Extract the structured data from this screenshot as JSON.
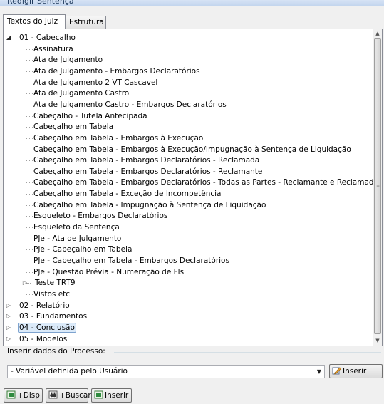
{
  "window": {
    "title": "Redigir Sentença"
  },
  "tabs": [
    {
      "label": "Textos do Juiz",
      "active": true
    },
    {
      "label": "Estrutura",
      "active": false
    }
  ],
  "tree": {
    "root": {
      "label": "01 - Cabeçalho",
      "expanded": true
    },
    "children": [
      "Assinatura",
      "Ata de Julgamento",
      "Ata de Julgamento - Embargos Declaratórios",
      "Ata de Julgamento 2 VT Cascavel",
      "Ata de Julgamento Castro",
      "Ata de Julgamento Castro - Embargos Declaratórios",
      "Cabeçalho - Tutela Antecipada",
      "Cabeçalho em Tabela",
      "Cabeçalho em Tabela - Embargos à Execução",
      "Cabeçalho em Tabela - Embargos à Execução/Impugnação à Sentença de Liquidação",
      "Cabeçalho em Tabela - Embargos Declaratórios - Reclamada",
      "Cabeçalho em Tabela - Embargos Declaratórios - Reclamante",
      "Cabeçalho em Tabela - Embargos Declaratórios - Todas as Partes - Reclamante e Reclamado",
      "Cabeçalho em Tabela - Exceção de Incompetência",
      "Cabeçalho em Tabela - Impugnação à Sentença de Liquidação",
      "Esqueleto - Embargos Declaratórios",
      "Esqueleto da Sentença",
      "PJe - Ata de Julgamento",
      "PJe - Cabeçalho em Tabela",
      "PJe - Cabeçalho em Tabela - Embargos Declaratórios",
      "PJe - Questão Prévia - Numeração de Fls",
      "Teste TRT9",
      "Vistos etc"
    ],
    "collapsed_child": "Teste TRT9",
    "siblings": [
      "02 - Relatório",
      "03 - Fundamentos",
      "04 - Conclusão",
      "05 - Modelos"
    ],
    "selected": "04 - Conclusão"
  },
  "process_data": {
    "label": "Inserir dados do Processo:",
    "combo_value": "- Variável definida pelo Usuário",
    "insert_button": "Inserir"
  },
  "bottom_buttons": {
    "disp": "+Disp",
    "buscar": "+Buscar",
    "inserir": "Inserir"
  },
  "colors": {
    "selection_bg": "#dbeaf9",
    "selection_border": "#7da2ce",
    "panel_border": "#898c95"
  }
}
